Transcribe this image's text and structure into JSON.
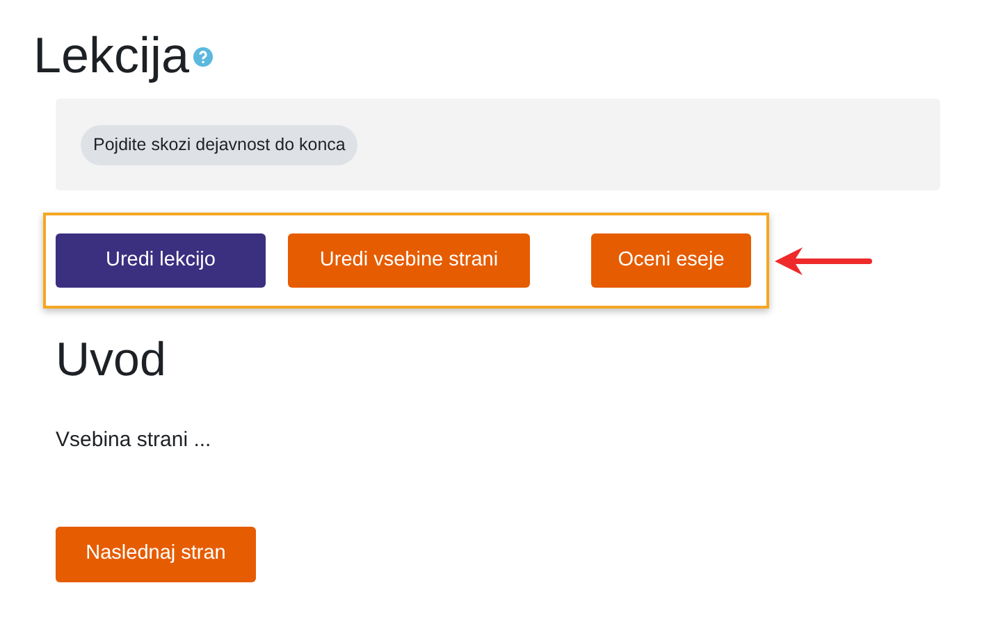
{
  "page_title": "Lekcija",
  "activity_badge": "Pojdite skozi dejavnost do konca",
  "toolbar_buttons": [
    {
      "label": "Uredi lekcijo",
      "kind": "primary"
    },
    {
      "label": "Uredi vsebine strani",
      "kind": "secondary"
    },
    {
      "label": "Oceni eseje",
      "kind": "secondary"
    }
  ],
  "section_heading": "Uvod",
  "body_text": "Vsebina strani ...",
  "next_button": {
    "label": "Naslednaj stran",
    "kind": "secondary"
  }
}
